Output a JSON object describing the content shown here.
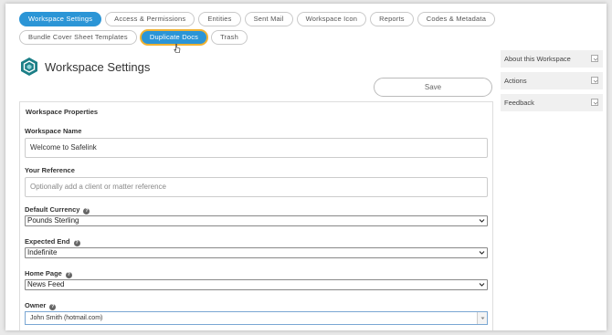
{
  "tabs": {
    "row1": [
      {
        "label": "Workspace Settings",
        "state": "active"
      },
      {
        "label": "Access & Permissions",
        "state": "normal"
      },
      {
        "label": "Entities",
        "state": "normal"
      },
      {
        "label": "Sent Mail",
        "state": "normal"
      },
      {
        "label": "Workspace Icon",
        "state": "normal"
      },
      {
        "label": "Reports",
        "state": "normal"
      },
      {
        "label": "Codes & Metadata",
        "state": "normal"
      }
    ],
    "row2": [
      {
        "label": "Bundle Cover Sheet Templates",
        "state": "normal"
      },
      {
        "label": "Duplicate Docs",
        "state": "hover"
      },
      {
        "label": "Trash",
        "state": "normal"
      }
    ]
  },
  "header": {
    "title": "Workspace Settings",
    "icon": "hexagon-logo-icon"
  },
  "toolbar": {
    "save_label": "Save"
  },
  "sidebar": {
    "items": [
      {
        "label": "About this Workspace"
      },
      {
        "label": "Actions"
      },
      {
        "label": "Feedback"
      }
    ]
  },
  "form": {
    "section_title": "Workspace Properties",
    "workspace_name": {
      "label": "Workspace Name",
      "value": "Welcome to Safelink"
    },
    "your_reference": {
      "label": "Your Reference",
      "placeholder": "Optionally add a client or matter reference"
    },
    "default_currency": {
      "label": "Default Currency",
      "value": "Pounds Sterling"
    },
    "expected_end": {
      "label": "Expected End",
      "value": "Indefinite"
    },
    "home_page": {
      "label": "Home Page",
      "value": "News Feed"
    },
    "owner": {
      "label": "Owner",
      "value": "John Smith (hotmail.com)"
    }
  },
  "colors": {
    "accent": "#2b95d6",
    "hover_ring": "#f0b232",
    "logo": "#1c7f87"
  }
}
